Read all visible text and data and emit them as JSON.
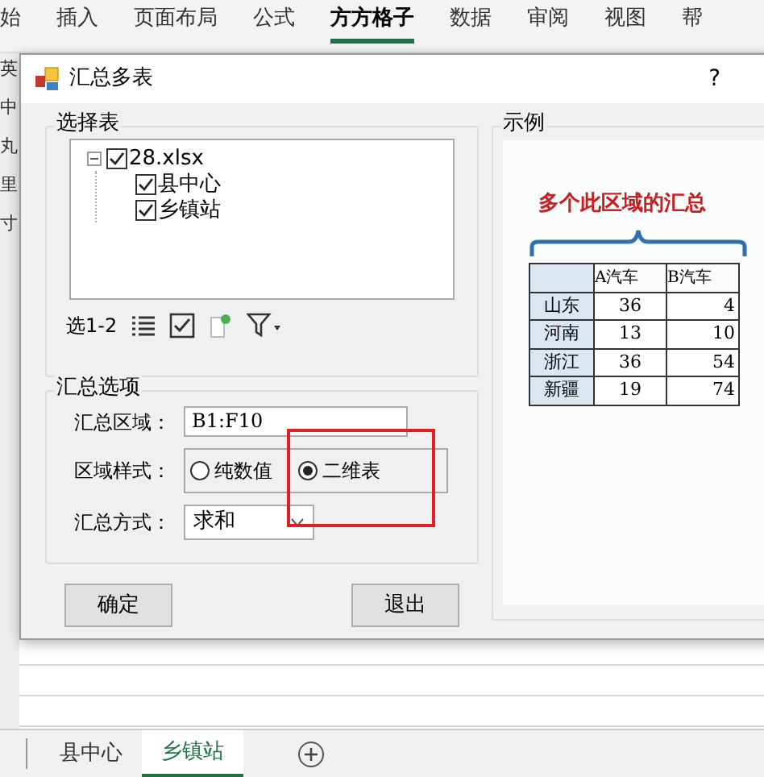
{
  "ribbon": {
    "tabs": [
      {
        "label": "始",
        "selected": false
      },
      {
        "label": "插入",
        "selected": false
      },
      {
        "label": "页面布局",
        "selected": false
      },
      {
        "label": "公式",
        "selected": false
      },
      {
        "label": "方方格子",
        "selected": true
      },
      {
        "label": "数据",
        "selected": false
      },
      {
        "label": "审阅",
        "selected": false
      },
      {
        "label": "视图",
        "selected": false
      },
      {
        "label": "帮",
        "selected": false
      }
    ]
  },
  "sheet_cells": [
    "英",
    "中",
    "丸",
    "里",
    "寸"
  ],
  "dialog": {
    "title": "汇总多表",
    "help": "?",
    "select_group": {
      "title": "选择表",
      "tree": [
        {
          "label": "28.xlsx",
          "checked": true,
          "expanded": true,
          "children": [
            {
              "label": "县中心",
              "checked": true
            },
            {
              "label": "乡镇站",
              "checked": true
            }
          ]
        }
      ],
      "toolbar_label": "选1-2"
    },
    "options_group": {
      "title": "汇总选项",
      "range_label": "汇总区域：",
      "range_value": "B1:F10",
      "style_label": "区域样式：",
      "style_options": [
        {
          "label": "纯数值",
          "selected": false
        },
        {
          "label": "二维表",
          "selected": true
        }
      ],
      "method_label": "汇总方式：",
      "method_value": "求和"
    },
    "buttons": [
      "确定",
      "退出"
    ],
    "example": {
      "title": "示例",
      "caption": "多个此区域的汇总",
      "columns": [
        "A汽车",
        "B汽车"
      ],
      "rows": [
        {
          "name": "山东",
          "values": [
            "36",
            "4"
          ]
        },
        {
          "name": "河南",
          "values": [
            "13",
            "10"
          ]
        },
        {
          "name": "浙江",
          "values": [
            "36",
            "54"
          ]
        },
        {
          "name": "新疆",
          "values": [
            "19",
            "74"
          ]
        }
      ]
    }
  },
  "sheet_tabs": [
    {
      "label": "县中心",
      "selected": false
    },
    {
      "label": "乡镇站",
      "selected": true
    }
  ]
}
